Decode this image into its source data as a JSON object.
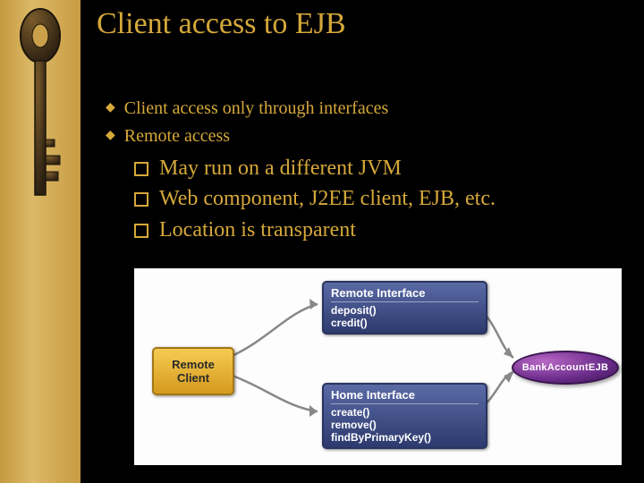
{
  "title": "Client access to EJB",
  "bullets": {
    "items": [
      "Client access only through interfaces",
      "Remote access"
    ],
    "sub": [
      "May run on a different JVM",
      "Web component, J2EE client, EJB, etc.",
      "Location is transparent"
    ]
  },
  "diagram": {
    "remote_client": "Remote Client",
    "remote_interface": {
      "header": "Remote Interface",
      "methods": [
        "deposit()",
        "credit()"
      ]
    },
    "home_interface": {
      "header": "Home Interface",
      "methods": [
        "create()",
        "remove()",
        "findByPrimaryKey()"
      ]
    },
    "ejb": "BankAccountEJB"
  }
}
